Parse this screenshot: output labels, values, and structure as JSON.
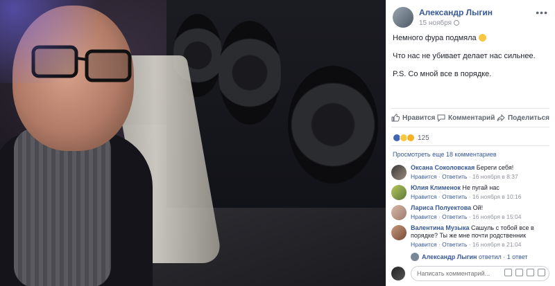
{
  "post": {
    "author": "Александр Лыгин",
    "date": "15 ноября",
    "more": "•••",
    "lines": [
      "Немного фура подмяла",
      "Что нас не убивает делает нас сильнее.",
      "P.S. Со мной все в порядке."
    ]
  },
  "actions": {
    "like": "Нравится",
    "comment": "Комментарий",
    "share": "Поделиться"
  },
  "reactions": {
    "count": "125",
    "icons": [
      "like-icon",
      "wow-icon",
      "sad-icon"
    ],
    "colors": [
      "#4267b2",
      "#f7c744",
      "#f7b125"
    ]
  },
  "view_more": "Просмотреть еще 18 комментариев",
  "comments": [
    {
      "author": "Оксана Соколовская",
      "text": "Береги себя!",
      "like": "Нравится",
      "reply": "Ответить",
      "time": "16 ноября в 8:37"
    },
    {
      "author": "Юлия Клименок",
      "text": "Не пугай нас",
      "like": "Нравится",
      "reply": "Ответить",
      "time": "16 ноября в 10:16"
    },
    {
      "author": "Лариса Полуектова",
      "text": "Ой!",
      "like": "Нравится",
      "reply": "Ответить",
      "time": "16 ноября в 15:04"
    },
    {
      "author": "Валентина Музыка",
      "text": "Сашуль с тобой все в порядке? Ты же мне почти родственник",
      "like": "Нравится",
      "reply": "Ответить",
      "time": "16 ноября в 21:04"
    }
  ],
  "replies": {
    "author": "Александр Лыгин",
    "verb": "ответил",
    "count": "1 ответ"
  },
  "compose": {
    "placeholder": "Написать комментарий..."
  },
  "colors": {
    "accent": "#365899",
    "meta": "#90949c"
  }
}
